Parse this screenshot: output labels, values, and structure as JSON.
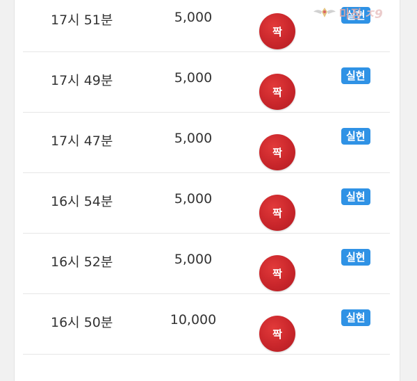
{
  "logo": {
    "text": "마징",
    "tail": "ㅈ9"
  },
  "bet_rows": [
    {
      "time": "17시 51분",
      "amount": "5,000",
      "pick": "짝",
      "status": "실현"
    },
    {
      "time": "17시 49분",
      "amount": "5,000",
      "pick": "짝",
      "status": "실현"
    },
    {
      "time": "17시 47분",
      "amount": "5,000",
      "pick": "짝",
      "status": "실현"
    },
    {
      "time": "16시 54분",
      "amount": "5,000",
      "pick": "짝",
      "status": "실현"
    },
    {
      "time": "16시 52분",
      "amount": "5,000",
      "pick": "짝",
      "status": "실현"
    },
    {
      "time": "16시 50분",
      "amount": "10,000",
      "pick": "짝",
      "status": "실현"
    }
  ],
  "colors": {
    "pick_ball": "#c9262b",
    "status_badge": "#2f92e5",
    "divider": "#e6e6e6"
  }
}
